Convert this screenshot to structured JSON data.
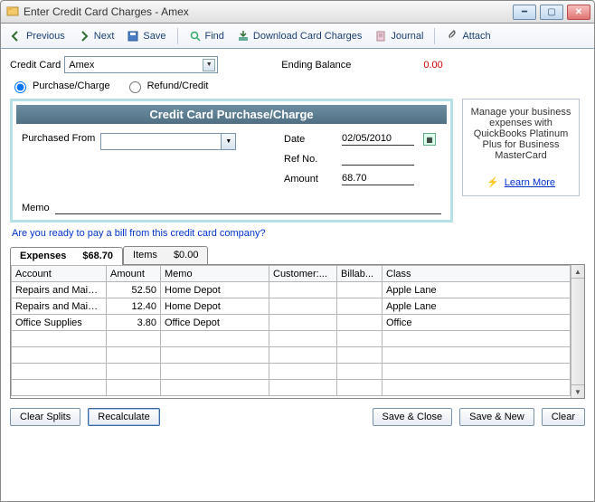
{
  "window": {
    "title": "Enter Credit Card Charges - Amex"
  },
  "toolbar": {
    "previous": "Previous",
    "next": "Next",
    "save": "Save",
    "find": "Find",
    "download": "Download Card Charges",
    "journal": "Journal",
    "attach": "Attach"
  },
  "form": {
    "credit_card_label": "Credit Card",
    "credit_card_value": "Amex",
    "ending_balance_label": "Ending Balance",
    "ending_balance_value": "0.00",
    "purchase_radio": "Purchase/Charge",
    "refund_radio": "Refund/Credit"
  },
  "purchase": {
    "title": "Credit Card Purchase/Charge",
    "purchased_from_label": "Purchased From",
    "purchased_from_value": "",
    "date_label": "Date",
    "date_value": "02/05/2010",
    "refno_label": "Ref No.",
    "refno_value": "",
    "amount_label": "Amount",
    "amount_value": "68.70",
    "memo_label": "Memo",
    "memo_value": ""
  },
  "bill_link": "Are you ready to pay a bill from this credit card company?",
  "promo": {
    "text": "Manage your business expenses with QuickBooks Platinum Plus for Business MasterCard",
    "link": "Learn More"
  },
  "tabs": {
    "expenses_label": "Expenses",
    "expenses_amount": "$68.70",
    "items_label": "Items",
    "items_amount": "$0.00"
  },
  "grid": {
    "headers": {
      "account": "Account",
      "amount": "Amount",
      "memo": "Memo",
      "customer": "Customer:...",
      "billable": "Billab...",
      "class": "Class"
    },
    "rows": [
      {
        "account": "Repairs and Maint...",
        "amount": "52.50",
        "memo": "Home Depot",
        "customer": "",
        "billable": "",
        "class": "Apple Lane"
      },
      {
        "account": "Repairs and Maint...",
        "amount": "12.40",
        "memo": "Home Depot",
        "customer": "",
        "billable": "",
        "class": "Apple Lane"
      },
      {
        "account": "Office Supplies",
        "amount": "3.80",
        "memo": "Office Depot",
        "customer": "",
        "billable": "",
        "class": "Office"
      }
    ]
  },
  "buttons": {
    "clear_splits": "Clear Splits",
    "recalculate": "Recalculate",
    "save_close": "Save & Close",
    "save_new": "Save & New",
    "clear": "Clear"
  }
}
